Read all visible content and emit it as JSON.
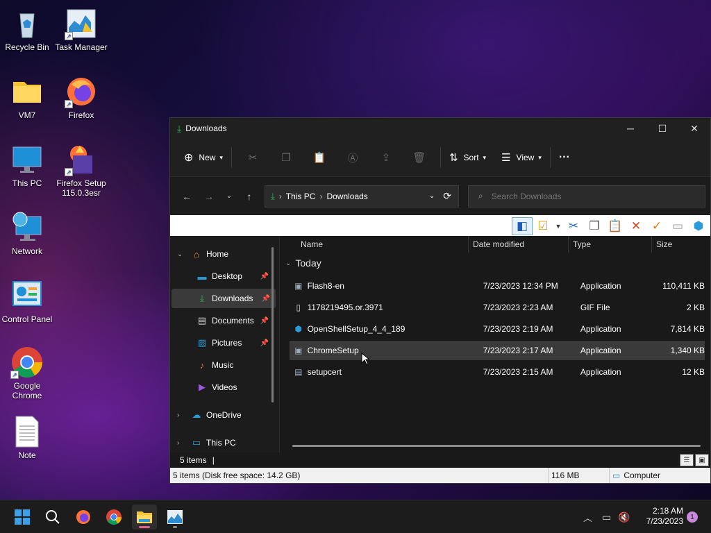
{
  "desktop": {
    "icons": [
      {
        "label": "Recycle Bin"
      },
      {
        "label": "Task Manager"
      },
      {
        "label": "VM7"
      },
      {
        "label": "Firefox"
      },
      {
        "label": "This PC"
      },
      {
        "label": "Firefox Setup 115.0.3esr"
      },
      {
        "label": "Network"
      },
      {
        "label": "Control Panel"
      },
      {
        "label": "Google Chrome"
      },
      {
        "label": "Note"
      }
    ]
  },
  "window": {
    "title": "Downloads",
    "commands": {
      "new_label": "New",
      "sort_label": "Sort",
      "view_label": "View",
      "more_label": "···"
    },
    "address": {
      "crumbs": [
        "This PC",
        "Downloads"
      ],
      "search_placeholder": "Search Downloads"
    },
    "nav": {
      "items": [
        {
          "label": "Home"
        },
        {
          "label": "Desktop"
        },
        {
          "label": "Downloads"
        },
        {
          "label": "Documents"
        },
        {
          "label": "Pictures"
        },
        {
          "label": "Music"
        },
        {
          "label": "Videos"
        },
        {
          "label": "OneDrive"
        },
        {
          "label": "This PC"
        }
      ]
    },
    "columns": {
      "name": "Name",
      "date": "Date modified",
      "type": "Type",
      "size": "Size"
    },
    "group_label": "Today",
    "files": [
      {
        "name": "Flash8-en",
        "date": "7/23/2023 12:34 PM",
        "type": "Application",
        "size": "110,411 KB"
      },
      {
        "name": "1178219495.or.3971",
        "date": "7/23/2023 2:23 AM",
        "type": "GIF File",
        "size": "2 KB"
      },
      {
        "name": "OpenShellSetup_4_4_189",
        "date": "7/23/2023 2:19 AM",
        "type": "Application",
        "size": "7,814 KB"
      },
      {
        "name": "ChromeSetup",
        "date": "7/23/2023 2:17 AM",
        "type": "Application",
        "size": "1,340 KB"
      },
      {
        "name": "setupcert",
        "date": "7/23/2023 2:15 AM",
        "type": "Application",
        "size": "12 KB"
      }
    ],
    "status": {
      "count": "5 items",
      "classic_left": "5 items (Disk free space: 14.2 GB)",
      "classic_mid": "116 MB",
      "classic_right": "Computer"
    }
  },
  "taskbar": {
    "clock_time": "2:18 AM",
    "clock_date": "7/23/2023",
    "notification_count": "1"
  },
  "colors": {
    "accent": "#60cdff",
    "selection": "#3a3a3a",
    "pink": "#e06090"
  }
}
